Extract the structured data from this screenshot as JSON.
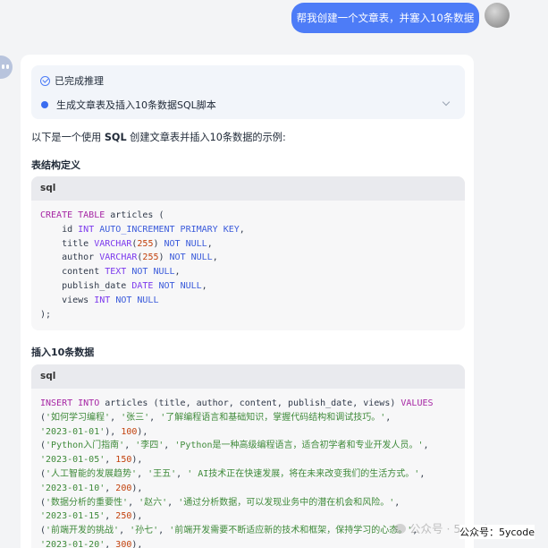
{
  "user_message": "帮我创建一个文章表，并塞入10条数据",
  "reasoning": {
    "status": "已完成推理",
    "step": "生成文章表及插入10条数据SQL脚本"
  },
  "intro": {
    "before": "以下是一个使用 ",
    "bold": "SQL",
    "after": " 创建文章表并插入10条数据的示例:"
  },
  "sections": [
    {
      "title": "表结构定义",
      "lang": "sql",
      "lines": [
        [
          [
            "kw",
            "CREATE TABLE"
          ],
          [
            "p",
            " articles ("
          ]
        ],
        [
          [
            "p",
            "    id "
          ],
          [
            "ty",
            "INT"
          ],
          [
            "p",
            " "
          ],
          [
            "kn",
            "AUTO_INCREMENT PRIMARY KEY"
          ],
          [
            "p",
            ","
          ]
        ],
        [
          [
            "p",
            "    title "
          ],
          [
            "ty",
            "VARCHAR"
          ],
          [
            "p",
            "("
          ],
          [
            "num",
            "255"
          ],
          [
            "p",
            ") "
          ],
          [
            "kn",
            "NOT NULL"
          ],
          [
            "p",
            ","
          ]
        ],
        [
          [
            "p",
            "    author "
          ],
          [
            "ty",
            "VARCHAR"
          ],
          [
            "p",
            "("
          ],
          [
            "num",
            "255"
          ],
          [
            "p",
            ") "
          ],
          [
            "kn",
            "NOT NULL"
          ],
          [
            "p",
            ","
          ]
        ],
        [
          [
            "p",
            "    content "
          ],
          [
            "ty",
            "TEXT"
          ],
          [
            "p",
            " "
          ],
          [
            "kn",
            "NOT NULL"
          ],
          [
            "p",
            ","
          ]
        ],
        [
          [
            "p",
            "    publish_date "
          ],
          [
            "ty",
            "DATE"
          ],
          [
            "p",
            " "
          ],
          [
            "kn",
            "NOT NULL"
          ],
          [
            "p",
            ","
          ]
        ],
        [
          [
            "p",
            "    views "
          ],
          [
            "ty",
            "INT"
          ],
          [
            "p",
            " "
          ],
          [
            "kn",
            "NOT NULL"
          ]
        ],
        [
          [
            "p",
            ");"
          ]
        ]
      ]
    },
    {
      "title": "插入10条数据",
      "lang": "sql",
      "lines": [
        [
          [
            "kw",
            "INSERT INTO"
          ],
          [
            "p",
            " articles (title, author, content, publish_date, views) "
          ],
          [
            "kw",
            "VALUES"
          ]
        ],
        [
          [
            "p",
            "("
          ],
          [
            "str",
            "'如何学习编程'"
          ],
          [
            "p",
            ", "
          ],
          [
            "str",
            "'张三'"
          ],
          [
            "p",
            ", "
          ],
          [
            "str",
            "'了解编程语言和基础知识，掌握代码结构和调试技巧。'"
          ],
          [
            "p",
            ","
          ]
        ],
        [
          [
            "str",
            "'2023-01-01'"
          ],
          [
            "p",
            "), "
          ],
          [
            "num",
            "100"
          ],
          [
            "p",
            "),"
          ]
        ],
        [
          [
            "p",
            "("
          ],
          [
            "str",
            "'Python入门指南'"
          ],
          [
            "p",
            ", "
          ],
          [
            "str",
            "'李四'"
          ],
          [
            "p",
            ", "
          ],
          [
            "str",
            "'Python是一种高级编程语言，适合初学者和专业开发人员。'"
          ],
          [
            "p",
            ","
          ]
        ],
        [
          [
            "str",
            "'2023-01-05'"
          ],
          [
            "p",
            ", "
          ],
          [
            "num",
            "150"
          ],
          [
            "p",
            "),"
          ]
        ],
        [
          [
            "p",
            "("
          ],
          [
            "str",
            "'人工智能的发展趋势'"
          ],
          [
            "p",
            ", "
          ],
          [
            "str",
            "'王五'"
          ],
          [
            "p",
            ", "
          ],
          [
            "str",
            "' AI技术正在快速发展，将在未来改变我们的生活方式。'"
          ],
          [
            "p",
            ","
          ]
        ],
        [
          [
            "str",
            "'2023-01-10'"
          ],
          [
            "p",
            ", "
          ],
          [
            "num",
            "200"
          ],
          [
            "p",
            "),"
          ]
        ],
        [
          [
            "p",
            "("
          ],
          [
            "str",
            "'数据分析的重要性'"
          ],
          [
            "p",
            ", "
          ],
          [
            "str",
            "'赵六'"
          ],
          [
            "p",
            ", "
          ],
          [
            "str",
            "'通过分析数据，可以发现业务中的潜在机会和风险。'"
          ],
          [
            "p",
            ","
          ]
        ],
        [
          [
            "str",
            "'2023-01-15'"
          ],
          [
            "p",
            ", "
          ],
          [
            "num",
            "250"
          ],
          [
            "p",
            "),"
          ]
        ],
        [
          [
            "p",
            "("
          ],
          [
            "str",
            "'前端开发的挑战'"
          ],
          [
            "p",
            ", "
          ],
          [
            "str",
            "'孙七'"
          ],
          [
            "p",
            ", "
          ],
          [
            "str",
            "'前端开发需要不断适应新的技术和框架，保持学习的心态。'"
          ],
          [
            "p",
            ","
          ]
        ],
        [
          [
            "str",
            "'2023-01-20'"
          ],
          [
            "p",
            ", "
          ],
          [
            "num",
            "300"
          ],
          [
            "p",
            "),"
          ]
        ]
      ]
    }
  ],
  "watermark": "公众号 · 5ycode",
  "credit": "公众号：5ycode"
}
